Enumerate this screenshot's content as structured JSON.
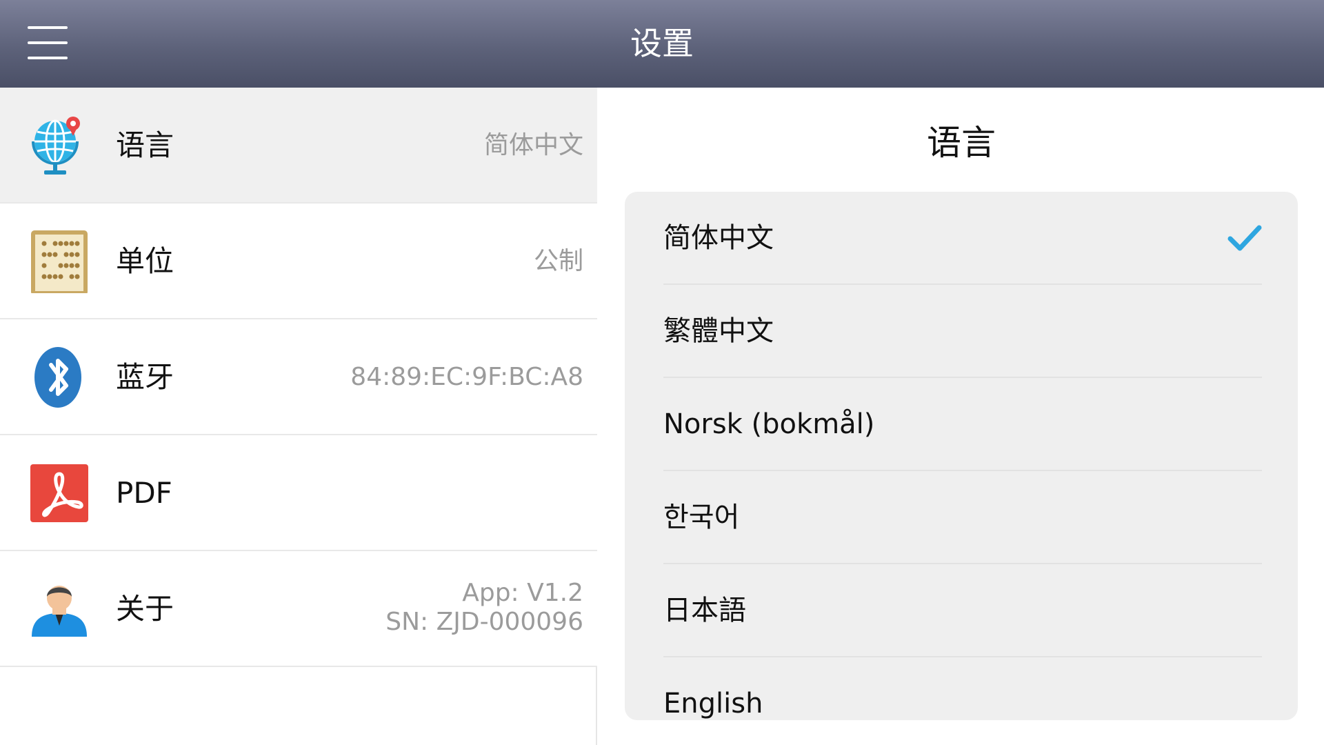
{
  "header": {
    "title": "设置"
  },
  "settings": {
    "items": [
      {
        "label": "语言",
        "value": "简体中文"
      },
      {
        "label": "单位",
        "value": "公制"
      },
      {
        "label": "蓝牙",
        "value": "84:89:EC:9F:BC:A8"
      },
      {
        "label": "PDF",
        "value": ""
      },
      {
        "label": "关于",
        "value_line1": "App: V1.2",
        "value_line2": "SN: ZJD-000096"
      }
    ]
  },
  "language_panel": {
    "title": "语言",
    "selected": "简体中文",
    "options": [
      "简体中文",
      "繁體中文",
      "Norsk (bokmål)",
      "한국어",
      "日本語",
      "English"
    ]
  },
  "colors": {
    "header_top": "#7c8099",
    "header_bottom": "#4a4f66",
    "check": "#2ea6e0",
    "selected_row": "#f0f0f0",
    "card": "#efefef"
  }
}
